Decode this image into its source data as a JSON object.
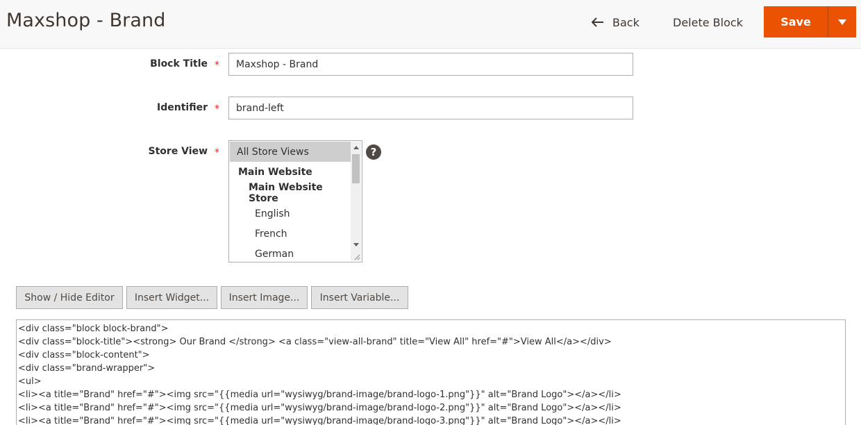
{
  "header": {
    "title": "Maxshop - Brand",
    "back_label": "Back",
    "delete_label": "Delete Block",
    "save_label": "Save",
    "accent_color": "#eb5202"
  },
  "form": {
    "block_title": {
      "label": "Block Title",
      "required_mark": "*",
      "value": "Maxshop - Brand"
    },
    "identifier": {
      "label": "Identifier",
      "required_mark": "*",
      "value": "brand-left"
    },
    "store_view": {
      "label": "Store View",
      "required_mark": "*",
      "help_glyph": "?",
      "options": [
        {
          "label": "All Store Views",
          "selected": true,
          "group": false,
          "indent": 0
        },
        {
          "label": "Main Website",
          "selected": false,
          "group": true,
          "indent": 1
        },
        {
          "label": "Main Website Store",
          "selected": false,
          "group": true,
          "indent": 2
        },
        {
          "label": "English",
          "selected": false,
          "group": false,
          "indent": 3
        },
        {
          "label": "French",
          "selected": false,
          "group": false,
          "indent": 3
        },
        {
          "label": "German",
          "selected": false,
          "group": false,
          "indent": 3
        }
      ]
    }
  },
  "editor": {
    "buttons": [
      "Show / Hide Editor",
      "Insert Widget...",
      "Insert Image...",
      "Insert Variable..."
    ],
    "content_lines": [
      "<div class=\"block block-brand\">",
      "<div class=\"block-title\"><strong> Our Brand </strong> <a class=\"view-all-brand\" title=\"View All\" href=\"#\">View All</a></div>",
      "<div class=\"block-content\">",
      "<div class=\"brand-wrapper\">",
      "<ul>",
      "<li><a title=\"Brand\" href=\"#\"><img src=\"{{media url=\"wysiwyg/brand-image/brand-logo-1.png\"}}\" alt=\"Brand Logo\"></a></li>",
      "<li><a title=\"Brand\" href=\"#\"><img src=\"{{media url=\"wysiwyg/brand-image/brand-logo-2.png\"}}\" alt=\"Brand Logo\"></a></li>",
      "<li><a title=\"Brand\" href=\"#\"><img src=\"{{media url=\"wysiwyg/brand-image/brand-logo-3.png\"}}\" alt=\"Brand Logo\"></a></li>"
    ]
  }
}
